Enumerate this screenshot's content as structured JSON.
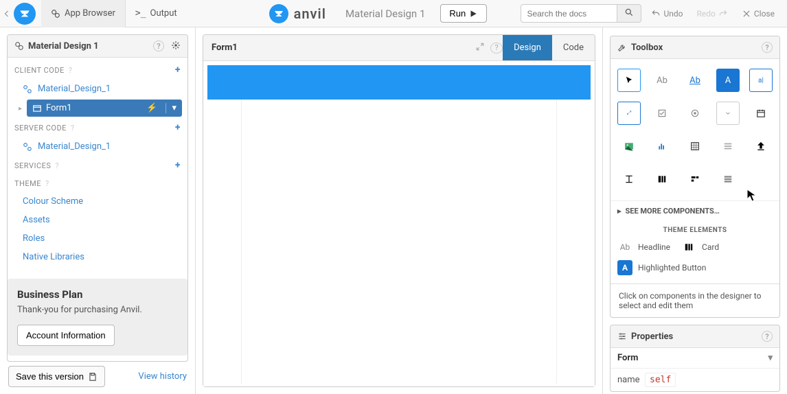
{
  "topbar": {
    "tab_app_browser": "App Browser",
    "tab_output": "Output",
    "brand": "anvil",
    "app_title": "Material Design 1",
    "run": "Run",
    "search_placeholder": "Search the docs",
    "undo": "Undo",
    "redo": "Redo",
    "close": "Close"
  },
  "left": {
    "title": "Material Design 1",
    "sections": {
      "client": "CLIENT CODE",
      "server": "SERVER CODE",
      "services": "SERVICES",
      "theme": "THEME"
    },
    "client_items": [
      "Material_Design_1"
    ],
    "client_sub": "Form1",
    "server_items": [
      "Material_Design_1"
    ],
    "theme_items": [
      "Colour Scheme",
      "Assets",
      "Roles",
      "Native Libraries"
    ],
    "plan": {
      "title": "Business Plan",
      "text": "Thank-you for purchasing Anvil.",
      "button": "Account Information"
    },
    "save": "Save this version",
    "history": "View history"
  },
  "center": {
    "title": "Form1",
    "tab_design": "Design",
    "tab_code": "Code"
  },
  "toolbox": {
    "title": "Toolbox",
    "see_more": "SEE MORE COMPONENTS…",
    "theme_heading": "THEME ELEMENTS",
    "elem_headline": "Headline",
    "elem_card": "Card",
    "elem_highlighted": "Highlighted Button",
    "hint": "Click on components in the designer to select and edit them"
  },
  "properties": {
    "title": "Properties",
    "section": "Form",
    "rows": [
      {
        "name": "name",
        "value": "self"
      }
    ]
  }
}
